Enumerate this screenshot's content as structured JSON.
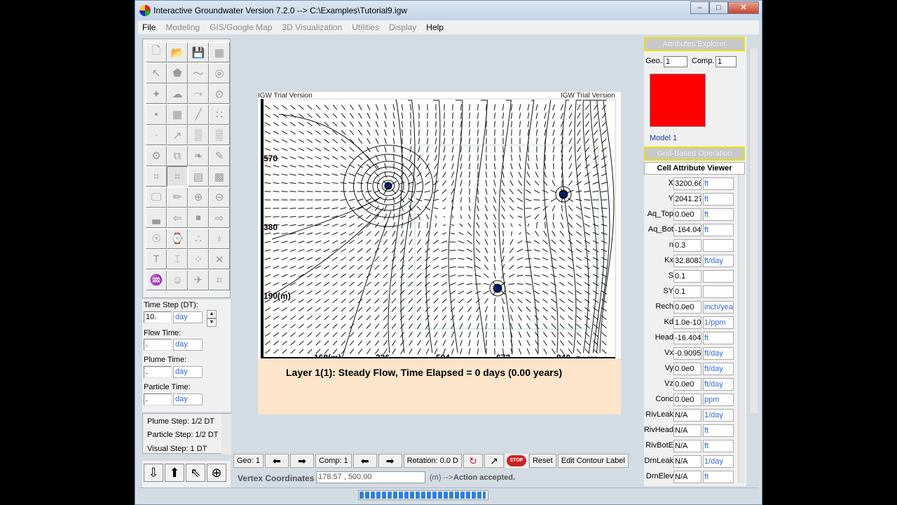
{
  "window": {
    "title": "Interactive Groundwater Version 7.2.0 --> C:\\Examples\\Tutorial9.igw",
    "minimize_icon": "minimize-icon",
    "maximize_icon": "maximize-icon",
    "close_icon": "close-icon"
  },
  "menu": [
    {
      "label": "File",
      "enabled": true
    },
    {
      "label": "Modeling",
      "enabled": false
    },
    {
      "label": "GIS/Google Map",
      "enabled": false
    },
    {
      "label": "3D Visualization",
      "enabled": false
    },
    {
      "label": "Utilities",
      "enabled": false
    },
    {
      "label": "Display",
      "enabled": false
    },
    {
      "label": "Help",
      "enabled": true
    }
  ],
  "tools": [
    "new-file-icon",
    "open-folder-icon",
    "save-icon",
    "grid-view-icon",
    "pointer-icon",
    "polygon-icon",
    "polyline-icon",
    "circle-icon",
    "point-add-icon",
    "shape-edit-icon",
    "line-edit-icon",
    "zoom-circle-icon",
    "dot-icon",
    "cell-grid-icon",
    "vertex-line-icon",
    "dots-grid-icon",
    "single-point-icon",
    "pointer-star-icon",
    "hatched-leaf-icon",
    "hatched-cloud-icon",
    "gear-grid-icon",
    "copy-grid-icon",
    "leaf-icon",
    "pen-icon",
    "grid-icon",
    "grid-active-icon",
    "grid-rows-icon",
    "grid-fill-icon",
    "monitor-icon",
    "brush-icon",
    "zoom-in-icon",
    "zoom-out-icon",
    "chart-icon",
    "left-arrow-icon",
    "stop-sign-icon",
    "right-arrow-icon",
    "eye-settings-icon",
    "clock-settings-icon",
    "particles-icon",
    "globe-settings-icon",
    "text-icon",
    "text-cursor-icon",
    "scatter-icon",
    "cross-icon",
    "fish-icon",
    "person-icon",
    "bird-icon",
    "opt-icon"
  ],
  "time": {
    "dt_label": "Time Step (DT):",
    "dt_value": "10.",
    "dt_unit": "day",
    "flow_label": "Flow Time:",
    "flow_value": ".",
    "flow_unit": "day",
    "plume_label": "Plume Time:",
    "plume_value": ".",
    "plume_unit": "day",
    "particle_label": "Particle Time:",
    "particle_value": ".",
    "particle_unit": "day"
  },
  "steps": {
    "plume": "Plume Step: 1/2 DT",
    "particle": "Particle Step: 1/2 DT",
    "visual": "Visual Step: 1 DT"
  },
  "plot": {
    "watermark_left": "IGW Trial Version",
    "watermark_right": "IGW Trial Version",
    "watermark_bottom": "Trial Version",
    "y_ticks": [
      "570",
      "380",
      "190(m)"
    ],
    "x_ticks": [
      "168(m)",
      "336",
      "504",
      "672",
      "840"
    ],
    "caption": "Layer 1(1): Steady Flow, Time Elapsed = 0 days (0.00 years)",
    "wells": [
      "well-1",
      "well-2",
      "well-3"
    ]
  },
  "attributes": {
    "header": "Attributes Explorer",
    "geo_label": "Geo.",
    "geo_value": "1",
    "comp_label": "Comp.",
    "comp_value": "1",
    "swatch_color": "#ff0000",
    "model_label": "Model 1",
    "grid_header": "Grid-Based Operation",
    "cell_viewer_title": "Cell Attribute Viewer",
    "rows": [
      {
        "name": "X",
        "value": "3200.66",
        "unit": "ft"
      },
      {
        "name": "Y",
        "value": "2041.27",
        "unit": "ft"
      },
      {
        "name": "Aq_Top",
        "value": "0.0e0",
        "unit": "ft"
      },
      {
        "name": "Aq_Bot",
        "value": "-164.04'",
        "unit": "ft"
      },
      {
        "name": "n",
        "value": "0.3",
        "unit": ""
      },
      {
        "name": "Kx",
        "value": "32.8083",
        "unit": "ft/day"
      },
      {
        "name": "S",
        "value": "0.1",
        "unit": ""
      },
      {
        "name": "SY",
        "value": "0.1",
        "unit": ""
      },
      {
        "name": "Rech",
        "value": "0.0e0",
        "unit": "inch/yea"
      },
      {
        "name": "Kd",
        "value": "1.0e-10",
        "unit": "1/ppm"
      },
      {
        "name": "Head",
        "value": "-16.404'",
        "unit": "ft"
      },
      {
        "name": "Vx",
        "value": "-0.9095;",
        "unit": "ft/day"
      },
      {
        "name": "Vy",
        "value": "0.0e0",
        "unit": "ft/day"
      },
      {
        "name": "Vz",
        "value": "0.0e0",
        "unit": "ft/day"
      },
      {
        "name": "Conc",
        "value": "0.0e0",
        "unit": "ppm"
      },
      {
        "name": "RivLeak",
        "value": "N/A",
        "unit": "1/day"
      },
      {
        "name": "RivHead",
        "value": "N/A",
        "unit": "ft"
      },
      {
        "name": "RivBotE",
        "value": "N/A",
        "unit": "ft"
      },
      {
        "name": "DrnLeak",
        "value": "N/A",
        "unit": "1/day"
      },
      {
        "name": "DrnElev",
        "value": "N/A",
        "unit": "ft"
      }
    ]
  },
  "bottom": {
    "geo": "Geo: 1",
    "comp": "Comp: 1",
    "rotation": "Rotation: 0.0 D",
    "stop": "STOP",
    "reset": "Reset",
    "edit_contour": "Edit Contour Label",
    "vertex_label": "Vertex Coordinates :",
    "vertex_value": "178.57 , 500.00",
    "vertex_unit": "(m) -->",
    "status": "Action accepted.",
    "progress_fraction": 0.98
  }
}
